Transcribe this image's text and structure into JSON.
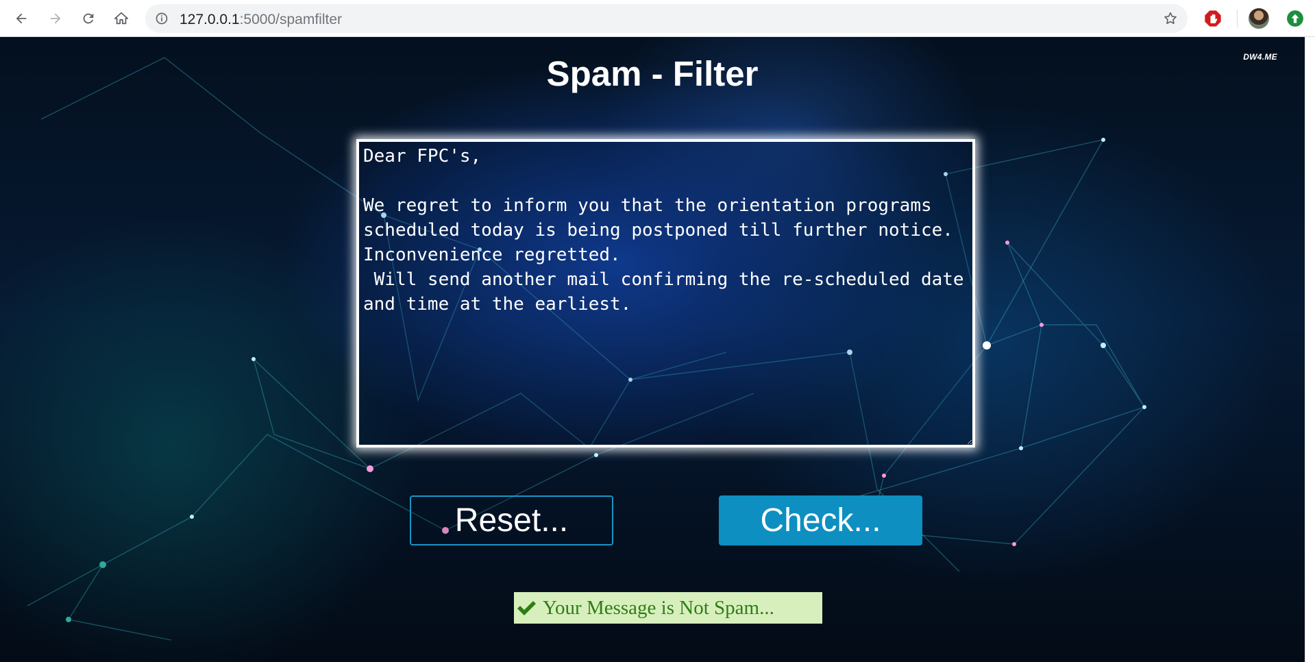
{
  "browser": {
    "url_host": "127.0.0.1",
    "url_path": ":5000/spamfilter"
  },
  "page": {
    "watermark": "DW4.ME",
    "title": "Spam - Filter",
    "message": "Dear FPC's,\n\nWe regret to inform you that the orientation programs scheduled today is being postponed till further notice.\nInconvenience regretted.\n Will send another mail confirming the re-scheduled date and time at the earliest.",
    "reset_label": "Reset...",
    "check_label": "Check...",
    "result_text": "Your Message is Not Spam..."
  },
  "colors": {
    "check_button": "#0d8fc1",
    "result_bg": "#d7efbd",
    "result_text": "#2e7d16"
  }
}
